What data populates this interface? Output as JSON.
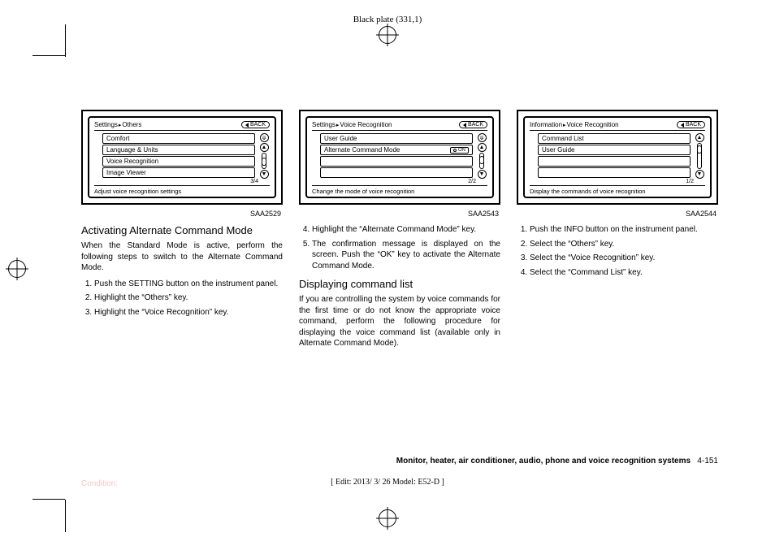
{
  "header": {
    "plate": "Black plate (331,1)"
  },
  "screens": [
    {
      "crumb_a": "Settings",
      "crumb_b": "Others",
      "rows": [
        "Comfort",
        "Language & Units",
        "Voice Recognition",
        "Image Viewer"
      ],
      "toggles": [
        null,
        null,
        null,
        null
      ],
      "counter": "3/4",
      "footer": "Adjust voice recognition settings",
      "caption": "SAA2529"
    },
    {
      "crumb_a": "Settings",
      "crumb_b": "Voice Recognition",
      "rows": [
        "User Guide",
        "Alternate Command Mode",
        "",
        ""
      ],
      "toggles": [
        null,
        "ON",
        null,
        null
      ],
      "counter": "2/2",
      "footer": "Change the mode of voice recognition",
      "caption": "SAA2543"
    },
    {
      "crumb_a": "Information",
      "crumb_b": "Voice Recognition",
      "rows": [
        "Command List",
        "User Guide",
        "",
        ""
      ],
      "toggles": [
        null,
        null,
        null,
        null
      ],
      "counter": "1/2",
      "footer": "Display the commands of voice recognition",
      "caption": "SAA2544"
    }
  ],
  "col1": {
    "h1": "Activating Alternate Command Mode",
    "p1": "When the Standard Mode is active, perform the following steps to switch to the Alternate Command Mode.",
    "li1": "Push the SETTING button on the instrument panel.",
    "li2": "Highlight the “Others” key.",
    "li3": "Highlight the “Voice Recognition” key."
  },
  "col2": {
    "li4": "Highlight the “Alternate Command Mode” key.",
    "li5": "The confirmation message is displayed on the screen. Push the “OK” key to activate the Alternate Command Mode.",
    "h2": "Displaying command list",
    "p2": "If you are controlling the system by voice commands for the first time or do not know the appropriate voice command, perform the following procedure for displaying the voice command list (available only in Alternate Command Mode)."
  },
  "col3": {
    "li1": "Push the INFO button on the instrument panel.",
    "li2": "Select the “Others” key.",
    "li3": "Select the “Voice Recognition” key.",
    "li4": "Select the “Command List” key."
  },
  "footer": {
    "section": "Monitor, heater, air conditioner, audio, phone and voice recognition systems",
    "page": "4-151",
    "edit": "[ Edit: 2013/ 3/ 26   Model: E52-D ]",
    "condition": "Condition:"
  }
}
